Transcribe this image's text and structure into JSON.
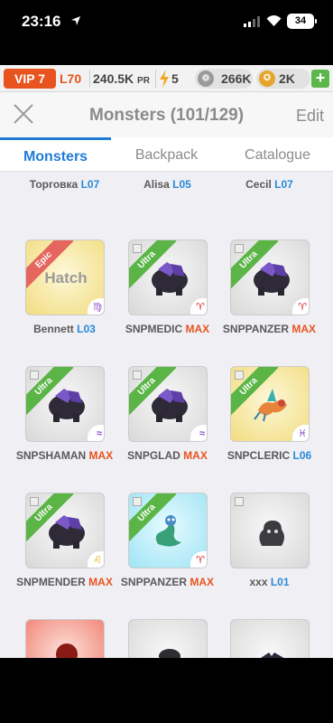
{
  "status": {
    "time": "23:16",
    "battery": "34"
  },
  "resources": {
    "vip": "VIP 7",
    "level": "L70",
    "power_value": "240.5K",
    "power_unit": "PR",
    "energy": "5",
    "paws": "266K",
    "gold": "2K",
    "add_label": "+"
  },
  "nav": {
    "title": "Monsters (101/129)",
    "edit": "Edit"
  },
  "tabs": [
    "Monsters",
    "Backpack",
    "Catalogue"
  ],
  "colors": {
    "accent": "#1e7bd8",
    "vip": "#e8541f",
    "ultra": "#5ab546",
    "epic": "#e5655f",
    "add": "#5cb84a"
  },
  "partial_row": [
    {
      "name": "Торговка",
      "level": "L07",
      "zodiac": "♌",
      "bg": "green"
    },
    {
      "name": "Alisa",
      "level": "L05",
      "zodiac": "♑",
      "bg": "blue"
    },
    {
      "name": "Cecil",
      "level": "L07",
      "zodiac": "♌",
      "bg": "green"
    }
  ],
  "monsters": [
    {
      "name": "Bennett",
      "level": "L03",
      "rarity": "Epic",
      "zodiac": "♍",
      "card": "yellow",
      "hatch": "Hatch"
    },
    {
      "name": "SNPMEDIC",
      "level": "MAX",
      "rarity": "Ultra",
      "zodiac": "♈",
      "card": "grey",
      "art": "rock"
    },
    {
      "name": "SNPPANZER",
      "level": "MAX",
      "rarity": "Ultra",
      "zodiac": "♈",
      "card": "grey",
      "art": "rock"
    },
    {
      "name": "SNPSHAMAN",
      "level": "MAX",
      "rarity": "Ultra",
      "zodiac": "≈",
      "card": "grey",
      "art": "rock"
    },
    {
      "name": "SNPGLAD",
      "level": "MAX",
      "rarity": "Ultra",
      "zodiac": "≈",
      "card": "grey",
      "art": "rock"
    },
    {
      "name": "SNPCLERIC",
      "level": "L06",
      "rarity": "Ultra",
      "zodiac": "♓",
      "card": "yellow",
      "art": "dragon"
    },
    {
      "name": "SNPMENDER",
      "level": "MAX",
      "rarity": "Ultra",
      "zodiac": "♌",
      "card": "grey",
      "art": "rock"
    },
    {
      "name": "SNPPANZER",
      "level": "MAX",
      "rarity": "Ultra",
      "zodiac": "♈",
      "card": "blue",
      "art": "serpent"
    },
    {
      "name": "xxx",
      "level": "L01",
      "rarity": "",
      "zodiac": "",
      "card": "grey",
      "art": "blob"
    }
  ],
  "bottom_row": [
    {
      "card": "red",
      "art": "red-orb"
    },
    {
      "card": "grey",
      "art": "dark-shape"
    },
    {
      "card": "grey",
      "art": "dark-wing"
    }
  ]
}
